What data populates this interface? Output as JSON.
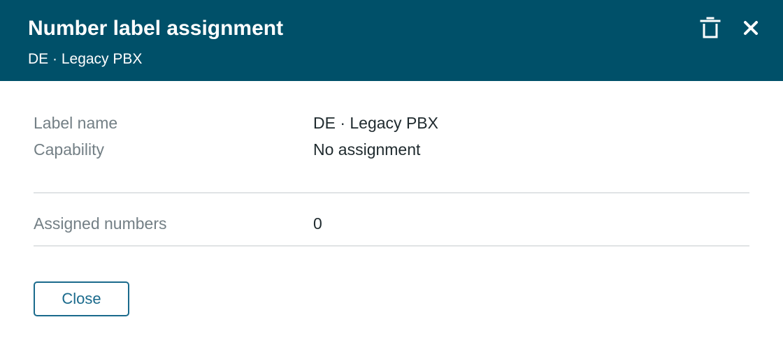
{
  "header": {
    "title": "Number label assignment",
    "subtitle": "DE · Legacy PBX",
    "delete_icon": "trash-icon",
    "close_icon": "close-icon",
    "background_color": "#005069"
  },
  "details": {
    "label_name": {
      "label": "Label name",
      "value": "DE · Legacy PBX"
    },
    "capability": {
      "label": "Capability",
      "value": "No assignment"
    },
    "assigned_numbers": {
      "label": "Assigned numbers",
      "value": "0"
    }
  },
  "footer": {
    "close_label": "Close",
    "accent_color": "#1a6a8c"
  }
}
